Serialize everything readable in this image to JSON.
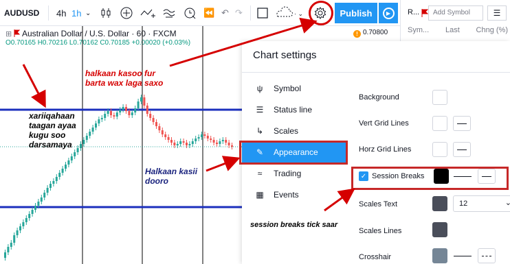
{
  "toolbar": {
    "symbol": "AUDUSD",
    "interval_1": "4h",
    "interval_2": "1h",
    "dropdown": "⌄",
    "publish_label": "Publish"
  },
  "price_badge": "0.70800",
  "watchlist": {
    "short": "R...",
    "add_symbol_placeholder": "Add Symbol",
    "columns": [
      "Sym...",
      "Last",
      "Chng (%)"
    ]
  },
  "chart": {
    "title": "Australian Dollar / U.S. Dollar · 60 · FXCM",
    "ohlc": "O0.70165  H0.70216  L0.70162  C0.70185  +0.00020 (+0.03%)"
  },
  "annotations": {
    "top_red": [
      "halkaan kasoo fur",
      "barta wax laga saxo"
    ],
    "left": [
      "xariiqahaan",
      "taagan ayaa",
      "kugu soo",
      "darsamaya"
    ],
    "blue": [
      "Halkaan kasii",
      "dooro"
    ],
    "bottom": "session breaks tick saar"
  },
  "dialog": {
    "title": "Chart settings",
    "nav": [
      "Symbol",
      "Status line",
      "Scales",
      "Appearance",
      "Trading",
      "Events"
    ],
    "rows": {
      "background": "Background",
      "vert_grid": "Vert Grid Lines",
      "horz_grid": "Horz Grid Lines",
      "session_breaks": "Session Breaks",
      "scales_text": "Scales Text",
      "scales_lines": "Scales Lines",
      "crosshair": "Crosshair"
    },
    "font_size": "12"
  },
  "colors": {
    "accent": "#2196f3",
    "annotation_red": "#d50000",
    "horizontal_line": "#1b2fbd",
    "candle_up": "#26a69a",
    "candle_down": "#ef5350"
  }
}
